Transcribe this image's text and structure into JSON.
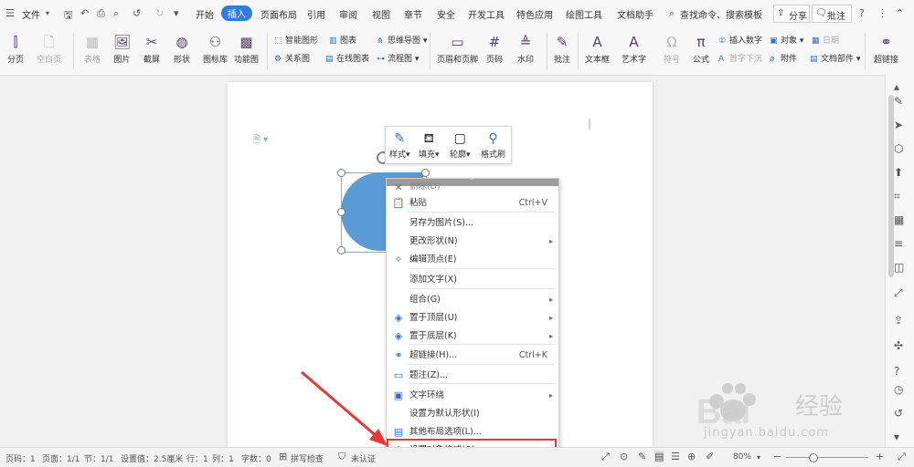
{
  "titlebar": {
    "file_menu": "文件",
    "menus": [
      "开始",
      "插入",
      "页面布局",
      "引用",
      "审阅",
      "视图",
      "章节",
      "安全",
      "开发工具",
      "特色应用",
      "绘图工具",
      "文档助手"
    ],
    "active_menu": "插入",
    "search": "查找命令、搜索模板",
    "share": "分享",
    "comment": "批注"
  },
  "ribbon": {
    "items": [
      {
        "label": "分页",
        "icon": "page-break-icon"
      },
      {
        "label": "空白页",
        "icon": "blank-page-icon"
      },
      {
        "label": "表格",
        "icon": "table-icon"
      },
      {
        "label": "图片",
        "icon": "picture-icon"
      },
      {
        "label": "截屏",
        "icon": "screenshot-icon"
      },
      {
        "label": "形状",
        "icon": "shapes-icon"
      },
      {
        "label": "图标库",
        "icon": "icon-library-icon"
      },
      {
        "label": "功能图",
        "icon": "function-chart-icon"
      },
      {
        "label": "页眉和页脚",
        "icon": "header-footer-icon"
      },
      {
        "label": "页码",
        "icon": "page-number-icon"
      },
      {
        "label": "水印",
        "icon": "watermark-icon"
      },
      {
        "label": "批注",
        "icon": "comment-icon"
      },
      {
        "label": "文本框",
        "icon": "text-box-icon"
      },
      {
        "label": "艺术字",
        "icon": "word-art-icon"
      },
      {
        "label": "符号",
        "icon": "symbol-icon"
      },
      {
        "label": "公式",
        "icon": "formula-icon"
      },
      {
        "label": "超链接",
        "icon": "hyperlink-icon"
      }
    ],
    "small": {
      "smart_shape": "智能图形",
      "chart": "图表",
      "mind_map": "思维导图",
      "relation": "关系图",
      "online_chart": "在线图表",
      "flowchart": "流程图",
      "insert_number": "插入数字",
      "object": "对象",
      "date": "日期",
      "first_drop": "首字下沉",
      "attachment": "附件",
      "doc_parts": "文档部件"
    }
  },
  "mini_toolbar": [
    "样式",
    "填充",
    "轮廓",
    "格式刷"
  ],
  "context_menu": {
    "delete": "删除(D)",
    "items": [
      {
        "label": "粘贴",
        "shortcut": "Ctrl+V",
        "icon": "paste-icon",
        "submenu": false
      },
      {
        "label": "另存为图片(S)...",
        "shortcut": "",
        "icon": "",
        "submenu": false
      },
      {
        "label": "更改形状(N)",
        "shortcut": "",
        "icon": "",
        "submenu": true
      },
      {
        "label": "编辑顶点(E)",
        "shortcut": "",
        "icon": "edit-points-icon",
        "submenu": false
      },
      {
        "label": "添加文字(X)",
        "shortcut": "",
        "icon": "",
        "submenu": false
      },
      {
        "label": "组合(G)",
        "shortcut": "",
        "icon": "",
        "submenu": true
      },
      {
        "label": "置于顶层(U)",
        "shortcut": "",
        "icon": "bring-front-icon",
        "submenu": true
      },
      {
        "label": "置于底层(K)",
        "shortcut": "",
        "icon": "send-back-icon",
        "submenu": true
      },
      {
        "label": "超链接(H)...",
        "shortcut": "Ctrl+K",
        "icon": "hyperlink-icon",
        "submenu": false
      },
      {
        "label": "题注(Z)...",
        "shortcut": "",
        "icon": "caption-icon",
        "submenu": false
      },
      {
        "label": "文字环绕",
        "shortcut": "",
        "icon": "text-wrap-icon",
        "submenu": true
      },
      {
        "label": "设置为默认形状(I)",
        "shortcut": "",
        "icon": "",
        "submenu": false
      },
      {
        "label": "其他布局选项(L)...",
        "shortcut": "",
        "icon": "layout-options-icon",
        "submenu": false
      },
      {
        "label": "设置对象格式(O)...",
        "shortcut": "",
        "icon": "format-object-icon",
        "submenu": false
      }
    ]
  },
  "status": {
    "page_num": "页码：1",
    "pages": "页面：1/1",
    "section": "节：1/1",
    "setting": "设置值：2.5厘米",
    "row": "行：1",
    "col": "列：1",
    "words": "字数：0",
    "spell": "拼写检查",
    "auth": "未认证",
    "zoom": "80%"
  },
  "watermark": {
    "text": "jingyan.baidu.com"
  },
  "colors": {
    "accent": "#2f7de1",
    "shape": "#5b9bd5",
    "highlight": "#e53935"
  }
}
